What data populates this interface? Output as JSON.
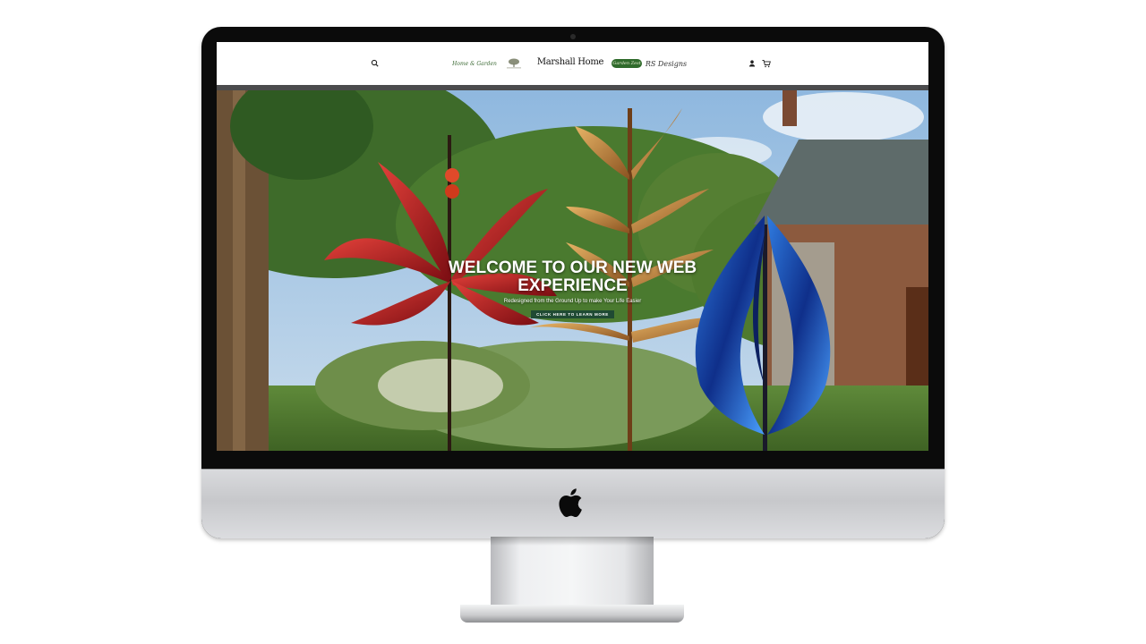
{
  "header": {
    "search_icon": "search-icon",
    "account_icon": "account-icon",
    "cart_icon": "cart-icon",
    "brands": [
      {
        "label": "Home & Garden"
      },
      {
        "label": ""
      },
      {
        "label": "Marshall Home",
        "tagline": "..."
      },
      {
        "label": "Garden Zest"
      },
      {
        "label": "RS Designs"
      }
    ]
  },
  "hero": {
    "title": "WELCOME TO OUR NEW WEB EXPERIENCE",
    "subtitle": "Redesigned from the Ground Up to make Your Life Easier",
    "cta_label": "CLICK HERE TO LEARN MORE"
  },
  "colors": {
    "cta_background": "#1f4a33",
    "header_bar": "#4b4b4d"
  }
}
